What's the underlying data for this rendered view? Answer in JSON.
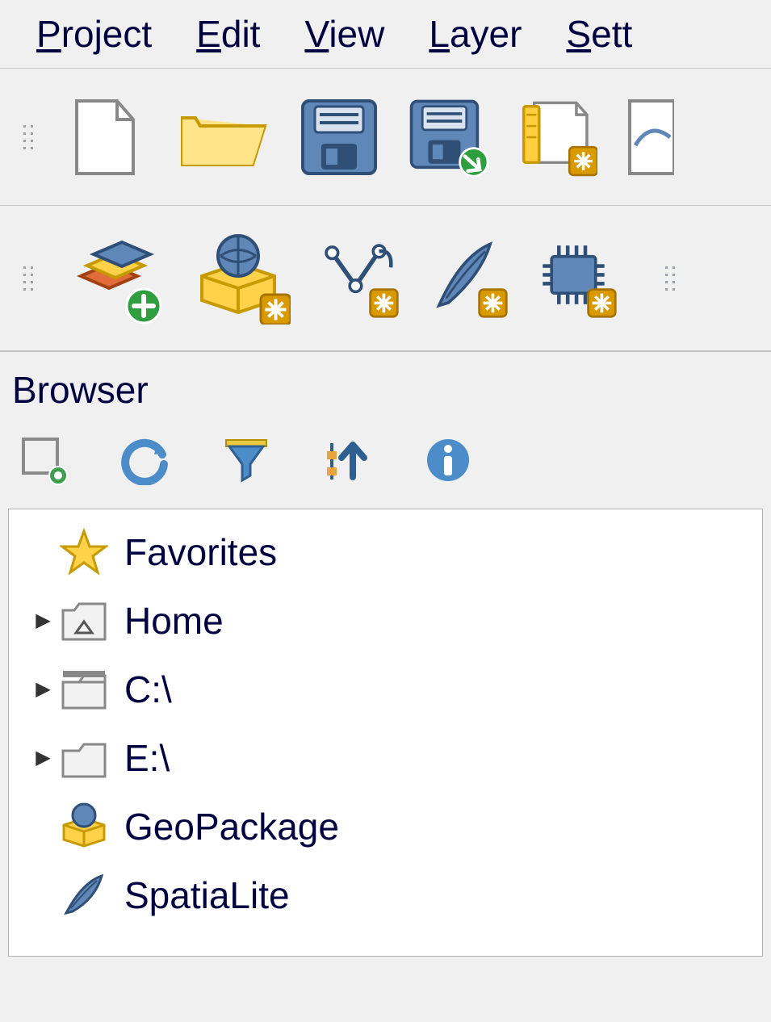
{
  "menu": {
    "p": {
      "u": "P",
      "rest": "roject"
    },
    "e": {
      "u": "E",
      "rest": "dit"
    },
    "v": {
      "u": "V",
      "rest": "iew"
    },
    "l": {
      "u": "L",
      "rest": "ayer"
    },
    "s": {
      "u": "S",
      "rest": "ett"
    }
  },
  "browser": {
    "title": "Browser",
    "items": {
      "favorites": {
        "label": "Favorites",
        "expandable": false
      },
      "home": {
        "label": "Home",
        "expandable": true
      },
      "c": {
        "label": "C:\\",
        "expandable": true
      },
      "e": {
        "label": "E:\\",
        "expandable": true
      },
      "geopackage": {
        "label": "GeoPackage",
        "expandable": false
      },
      "spatialite": {
        "label": "SpatiaLite",
        "expandable": false
      }
    }
  }
}
